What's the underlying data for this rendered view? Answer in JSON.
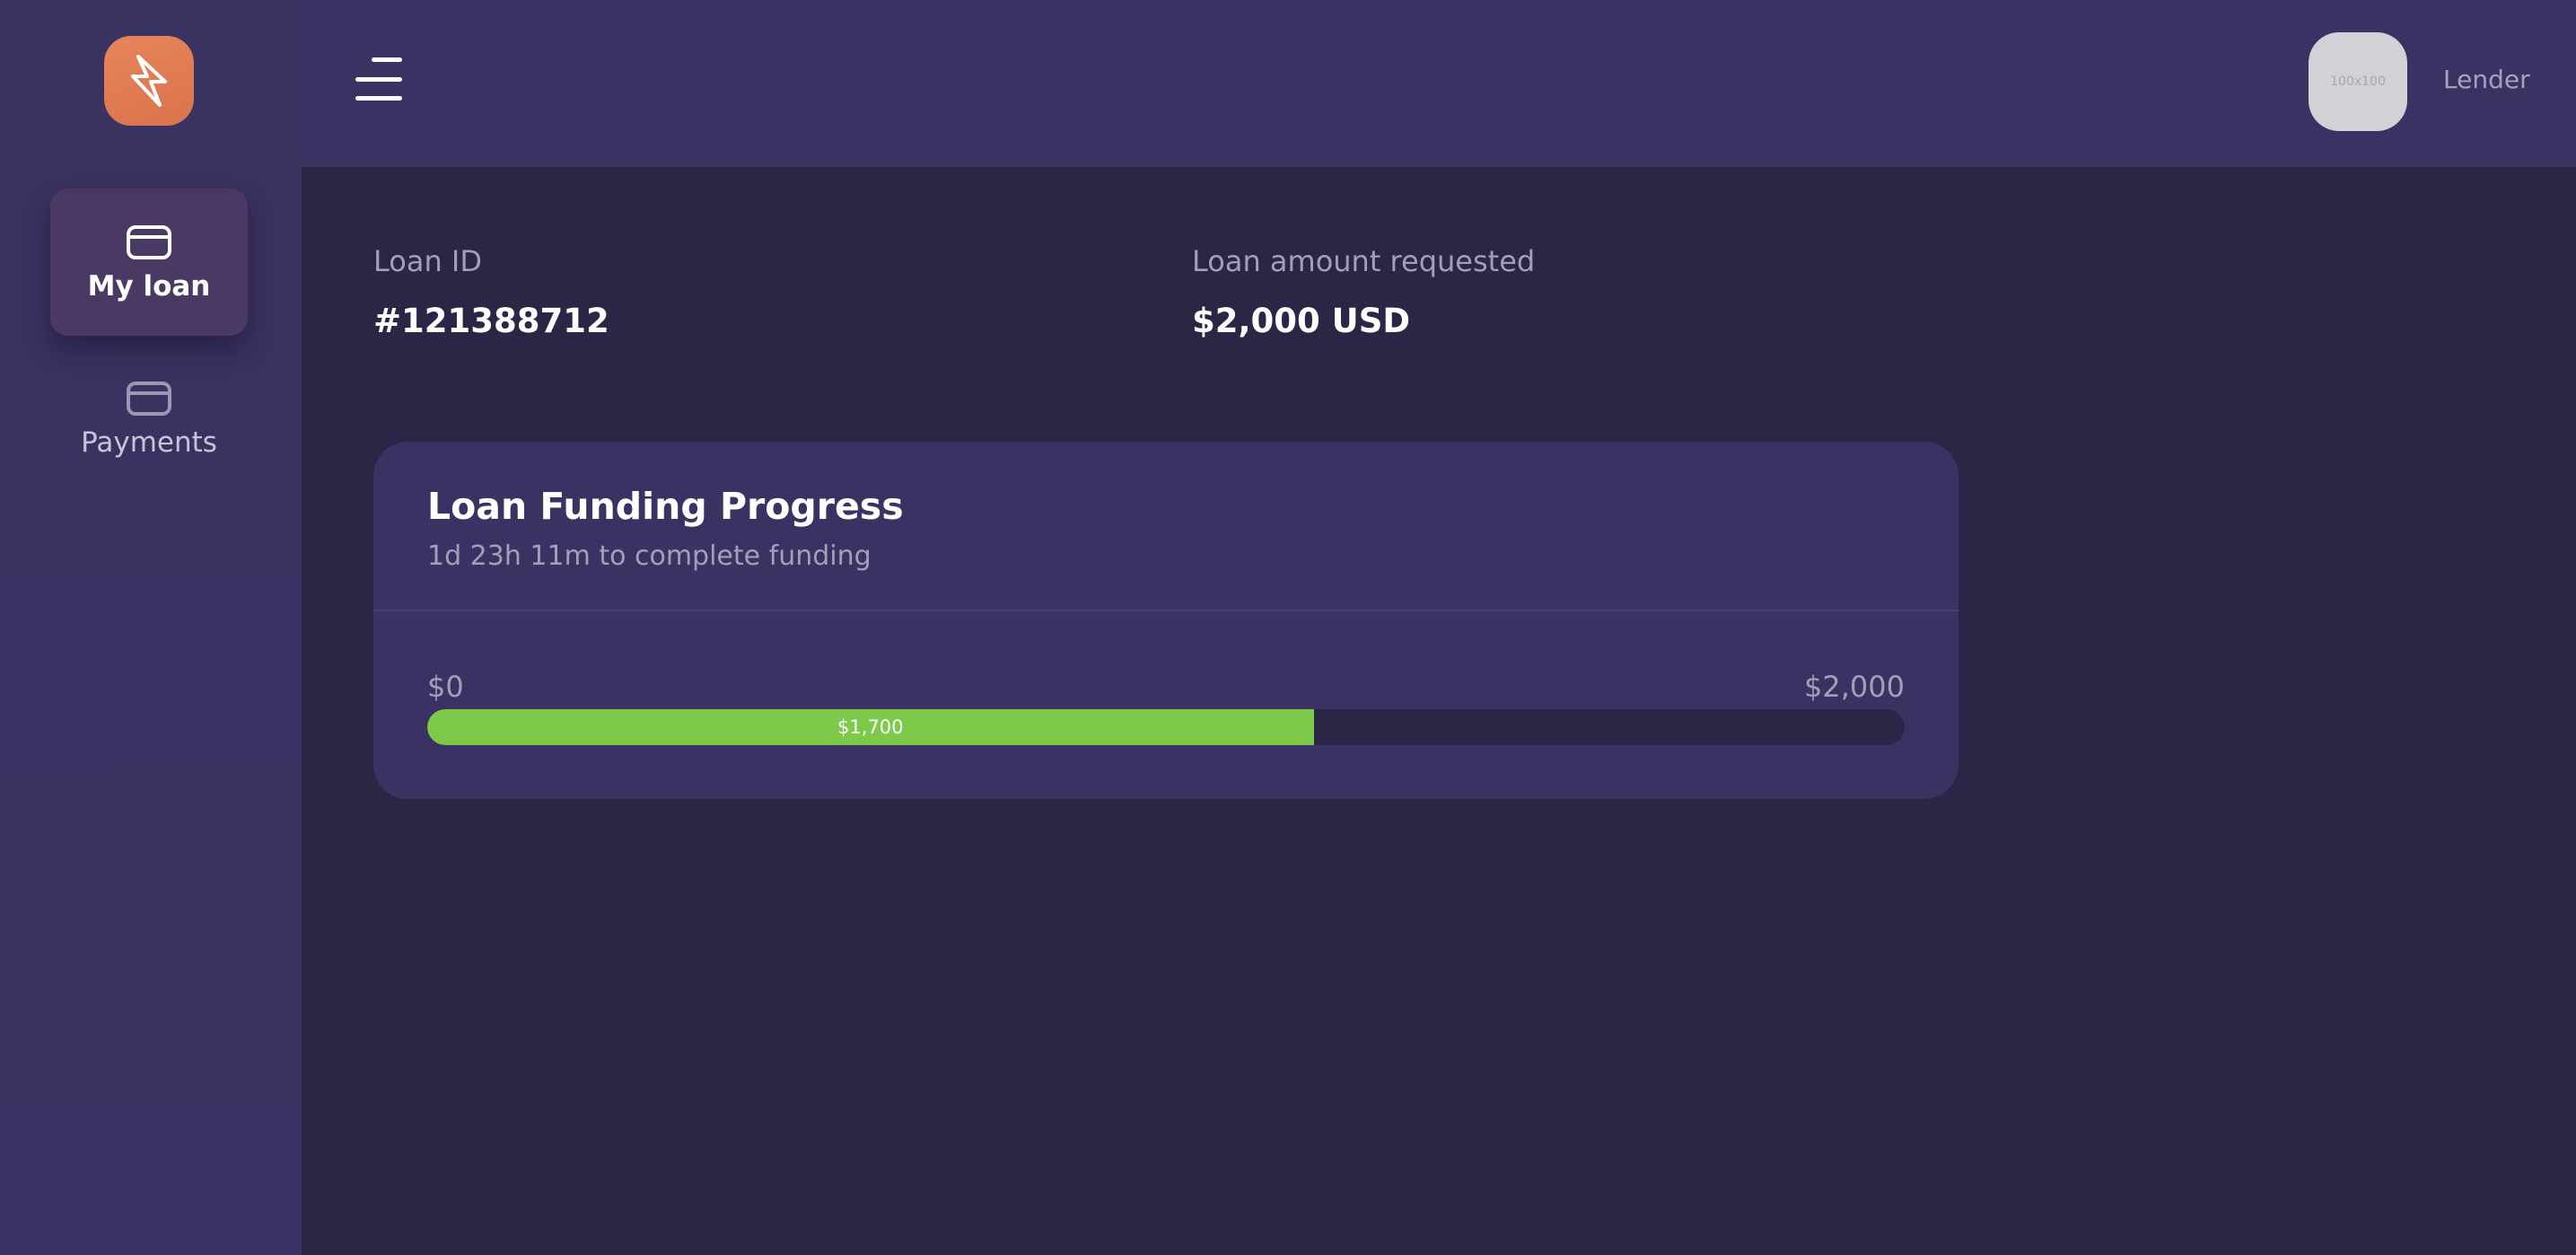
{
  "sidebar": {
    "logo_icon": "lightning-bolt-icon",
    "items": [
      {
        "label": "My loan",
        "icon": "wallet-icon",
        "active": true
      },
      {
        "label": "Payments",
        "icon": "wallet-icon",
        "active": false
      }
    ]
  },
  "header": {
    "menu_icon": "hamburger-menu-icon",
    "avatar_placeholder": "100x100",
    "user_role": "Lender"
  },
  "loan": {
    "id_label": "Loan ID",
    "id_value": "#121388712",
    "amount_label": "Loan amount requested",
    "amount_value": "$2,000 USD"
  },
  "funding": {
    "title": "Loan Funding Progress",
    "subtitle": "1d 23h 11m to complete funding",
    "min_label": "$0",
    "max_label": "$2,000",
    "current_label": "$1,700",
    "fraction_shown": 0.6
  },
  "colors": {
    "background": "#2b2546",
    "panel": "#3b3263",
    "accent_orange": "#e07d55",
    "progress_green": "#7dc94a",
    "muted_text": "#a49fb9"
  }
}
